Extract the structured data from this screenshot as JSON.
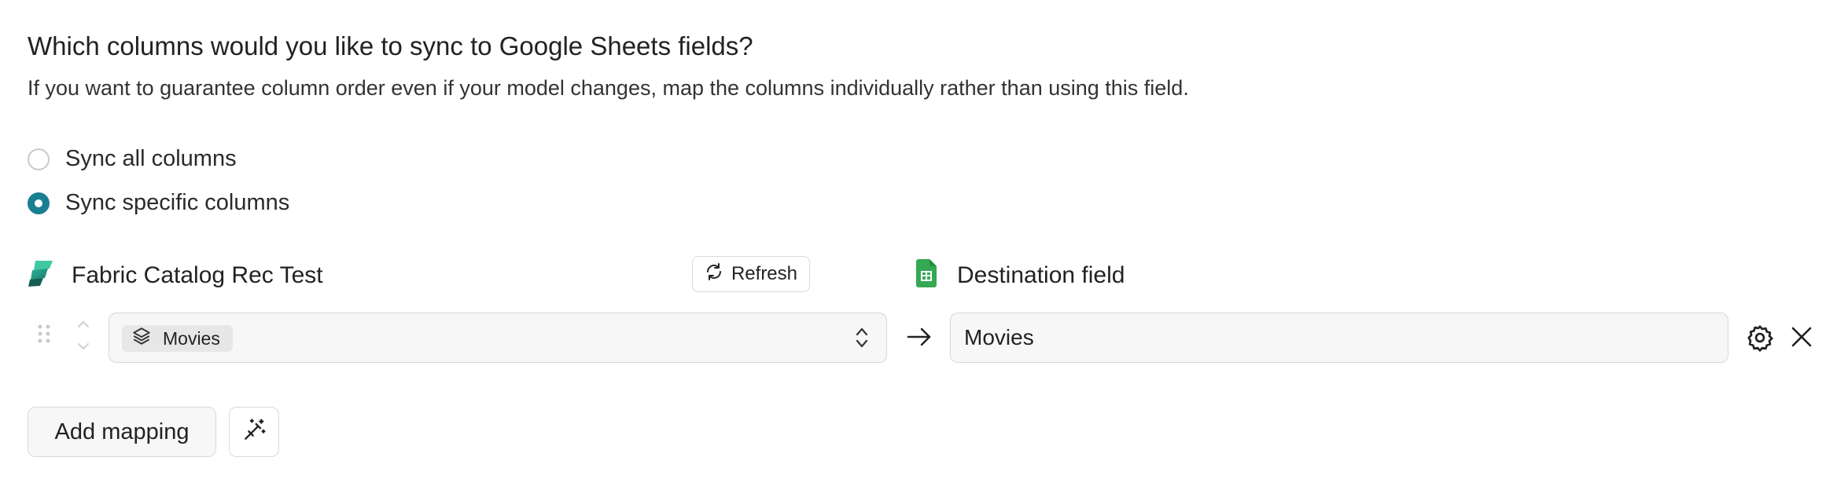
{
  "header": {
    "title": "Which columns would you like to sync to Google Sheets fields?",
    "description": "If you want to guarantee column order even if your model changes, map the columns individually rather than using this field."
  },
  "sync_options": [
    {
      "label": "Sync all columns",
      "selected": false
    },
    {
      "label": "Sync specific columns",
      "selected": true
    }
  ],
  "source": {
    "title": "Fabric Catalog Rec Test",
    "icon": "fabric-logo-icon",
    "refresh_label": "Refresh"
  },
  "destination": {
    "title": "Destination field",
    "icon": "google-sheets-icon"
  },
  "mapping": {
    "source_value": "Movies",
    "source_icon": "layers-icon",
    "destination_value": "Movies"
  },
  "actions": {
    "add_mapping_label": "Add mapping",
    "magic_icon": "magic-wand-icon"
  },
  "colors": {
    "accent": "#1b7f94",
    "sheets_green": "#34a853"
  }
}
